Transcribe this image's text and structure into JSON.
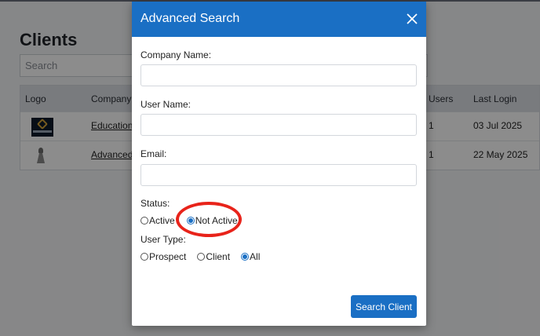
{
  "page": {
    "title": "Clients",
    "search_placeholder": "Search",
    "table": {
      "headers": {
        "logo": "Logo",
        "company": "Company N",
        "users": "Users",
        "last_login": "Last Login"
      },
      "rows": [
        {
          "company": "Education",
          "users": "1",
          "last_login": "03 Jul 2025",
          "logo_icon": "education-logo"
        },
        {
          "company": "Advanced",
          "users": "1",
          "last_login": "22 May 2025",
          "logo_icon": "chess-piece-logo"
        }
      ]
    }
  },
  "modal": {
    "title": "Advanced Search",
    "close_icon": "close-icon",
    "company_label": "Company Name:",
    "company_value": "",
    "user_label": "User Name:",
    "user_value": "",
    "email_label": "Email:",
    "email_value": "",
    "status_label": "Status:",
    "status_options": [
      "Active",
      "Not Active"
    ],
    "status_selected": "Not Active",
    "usertype_label": "User Type:",
    "usertype_options": [
      "Prospect",
      "Client",
      "All"
    ],
    "usertype_selected": "All",
    "submit_label": "Search Client",
    "accent_color": "#1a6fc4",
    "highlight_color": "#e8231a"
  }
}
